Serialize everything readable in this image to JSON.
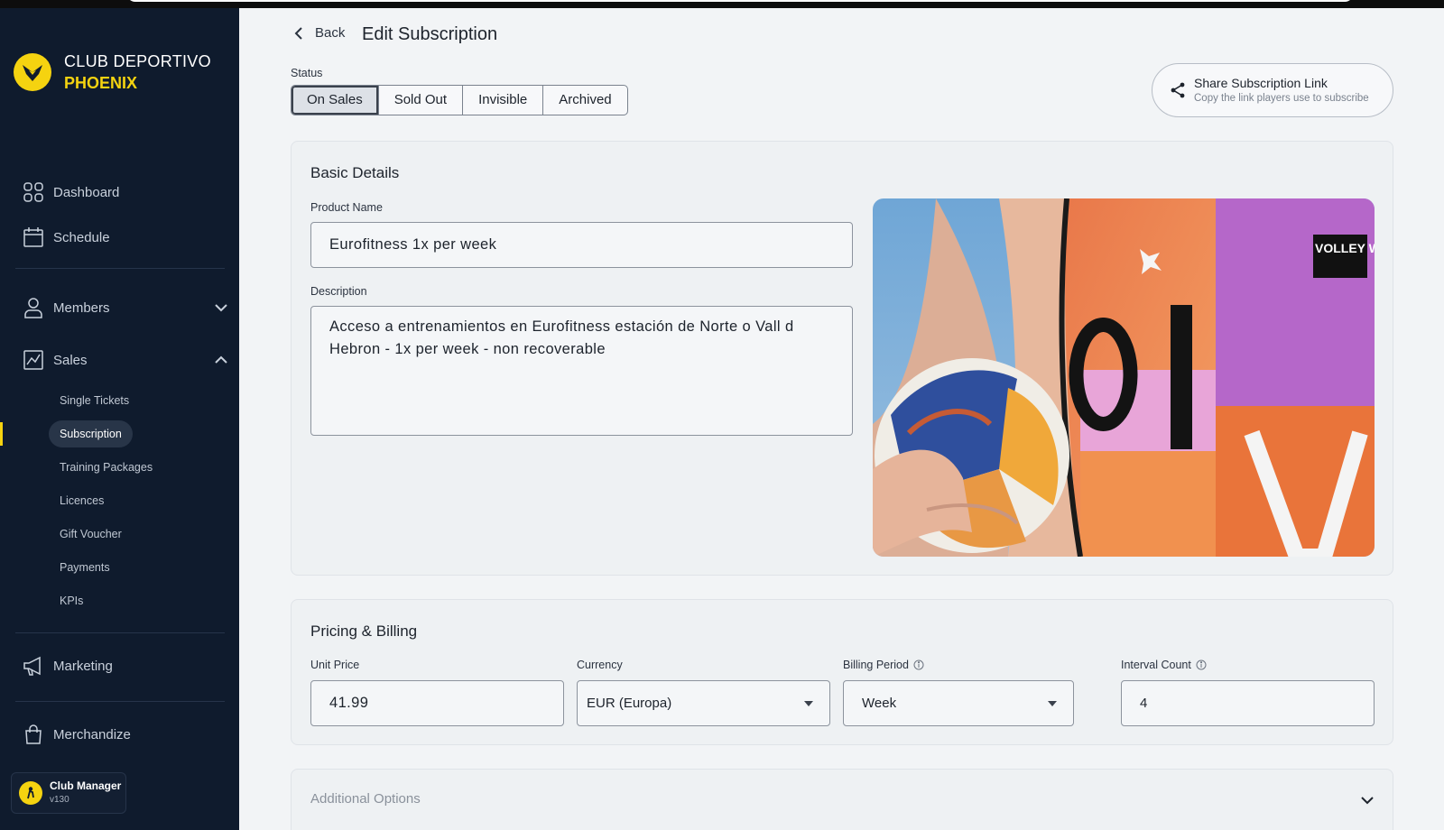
{
  "brand": {
    "line1": "CLUB DEPORTIVO",
    "line2": "PHOENIX",
    "logo_icon": "phoenix-bird-icon",
    "accent": "#f5d310"
  },
  "sidebar": {
    "bg": "#0f1b2d",
    "items": [
      {
        "label": "Dashboard",
        "icon": "dashboard-grid-icon"
      },
      {
        "label": "Schedule",
        "icon": "calendar-icon"
      },
      {
        "label": "Members",
        "icon": "user-icon",
        "expanded": false
      },
      {
        "label": "Sales",
        "icon": "chart-icon",
        "expanded": true
      },
      {
        "label": "Marketing",
        "icon": "megaphone-icon"
      },
      {
        "label": "Merchandize",
        "icon": "shopping-bag-icon"
      }
    ],
    "sales_sub": [
      "Single Tickets",
      "Subscription",
      "Training Packages",
      "Licences",
      "Gift Voucher",
      "Payments",
      "KPIs"
    ],
    "active_sub": "Subscription"
  },
  "profile": {
    "name": "Club Manager",
    "version": "v130"
  },
  "header": {
    "back_label": "Back",
    "title": "Edit Subscription"
  },
  "status": {
    "label": "Status",
    "options": [
      "On Sales",
      "Sold Out",
      "Invisible",
      "Archived"
    ],
    "selected": "On Sales"
  },
  "share": {
    "title": "Share Subscription Link",
    "subtitle": "Copy the link players use to subscribe",
    "icon": "share-icon"
  },
  "basic": {
    "title": "Basic Details",
    "product_label": "Product Name",
    "product_value": "Eurofitness 1x per week",
    "description_label": "Description",
    "description_value": "Acceso a entrenamientos en Eurofitness estación de Norte o Vall d Hebron - 1x per week - non recoverable",
    "image_text": "VOLLEY WORLD"
  },
  "pricing": {
    "title": "Pricing & Billing",
    "unit_price_label": "Unit Price",
    "unit_price_value": "41.99",
    "currency_label": "Currency",
    "currency_value": "EUR (Europa)",
    "billing_label": "Billing Period",
    "billing_value": "Week",
    "interval_label": "Interval Count",
    "interval_value": "4"
  },
  "additional": {
    "label": "Additional Options"
  }
}
